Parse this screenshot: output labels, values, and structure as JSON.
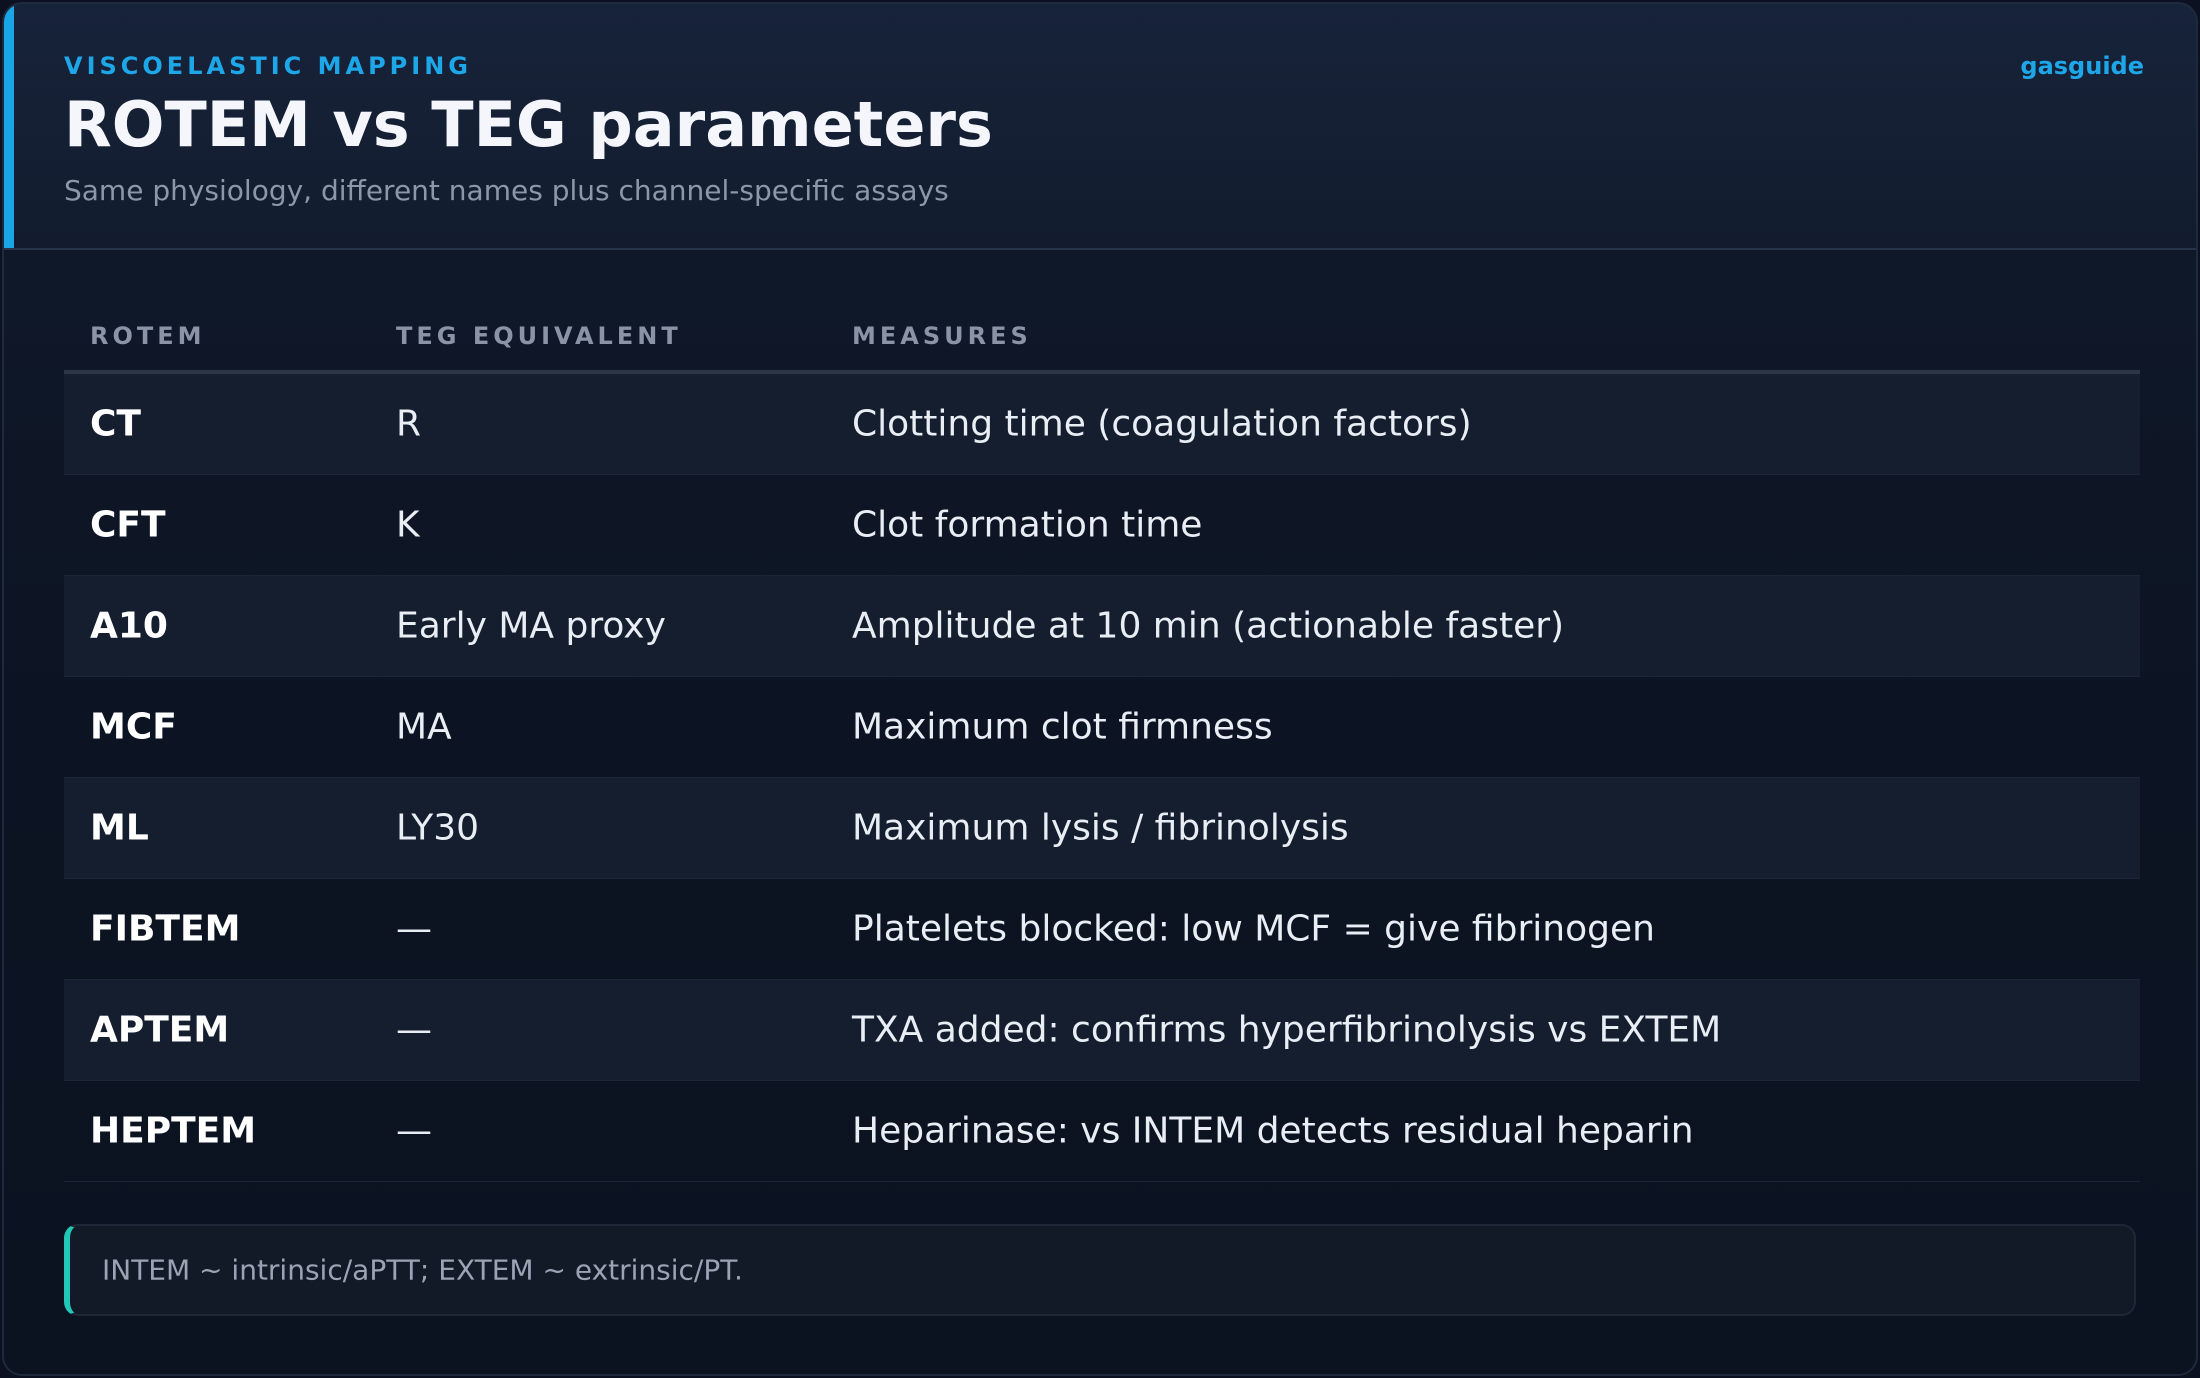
{
  "header": {
    "eyebrow": "VISCOELASTIC MAPPING",
    "brand": "gasguide",
    "title": "ROTEM vs TEG parameters",
    "subtitle": "Same physiology, different names plus channel-specific assays"
  },
  "table": {
    "columns": [
      "ROTEM",
      "TEG EQUIVALENT",
      "MEASURES"
    ],
    "rows": [
      {
        "rotem": "CT",
        "teg": "R",
        "measures": "Clotting time (coagulation factors)"
      },
      {
        "rotem": "CFT",
        "teg": "K",
        "measures": "Clot formation time"
      },
      {
        "rotem": "A10",
        "teg": "Early MA proxy",
        "measures": "Amplitude at 10 min (actionable faster)"
      },
      {
        "rotem": "MCF",
        "teg": "MA",
        "measures": "Maximum clot firmness"
      },
      {
        "rotem": "ML",
        "teg": "LY30",
        "measures": "Maximum lysis / fibrinolysis"
      },
      {
        "rotem": "FIBTEM",
        "teg": "—",
        "measures": "Platelets blocked: low MCF = give fibrinogen"
      },
      {
        "rotem": "APTEM",
        "teg": "—",
        "measures": "TXA added: confirms hyperfibrinolysis vs EXTEM"
      },
      {
        "rotem": "HEPTEM",
        "teg": "—",
        "measures": "Heparinase: vs INTEM detects residual heparin"
      }
    ]
  },
  "note": "INTEM ~ intrinsic/aPTT; EXTEM ~ extrinsic/PT.",
  "colors": {
    "accent": "#1aa6e6",
    "note_accent": "#22c7b8",
    "background": "#0b1120"
  }
}
